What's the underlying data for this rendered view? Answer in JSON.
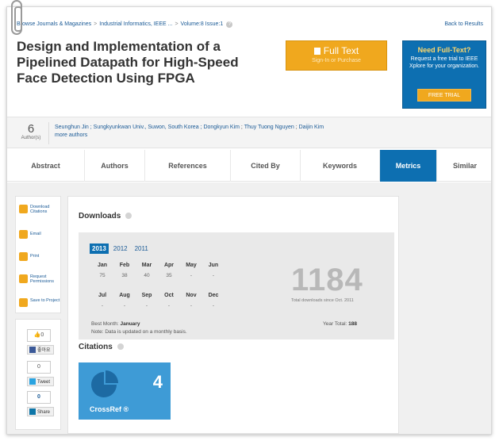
{
  "breadcrumb": {
    "items": [
      "Browse Journals & Magazines",
      "Industrial Informatics, IEEE ...",
      "Volume:8 Issue:1"
    ],
    "separator": ">"
  },
  "back_link": "Back to Results",
  "article": {
    "title": "Design and Implementation of a Pipelined Datapath for High-Speed Face Detection Using FPGA"
  },
  "full_text": {
    "label": "Full Text",
    "sub_label": "Sign-In or Purchase"
  },
  "promo": {
    "heading": "Need Full-Text?",
    "text": "Request a free trial to IEEE Xplore for your organization.",
    "button": "FREE TRIAL"
  },
  "authors": {
    "count": "6",
    "count_label": "Author(s)",
    "first": "Seunghun Jin ; Sungkyunkwan Univ., Suwon, South Korea ;",
    "links": [
      "Dongkyun Kim",
      "Thuy Tuong Nguyen",
      "Daijin Kim"
    ],
    "more": "more authors"
  },
  "tabs": [
    "Abstract",
    "Authors",
    "References",
    "Cited By",
    "Keywords",
    "Metrics",
    "Similar"
  ],
  "active_tab": "Metrics",
  "tools": [
    "Download Citations",
    "Email",
    "Print",
    "Request Permissions",
    "Save to Project"
  ],
  "social": {
    "like_count": "0",
    "like_label": "좋아요",
    "tweet_count": "0",
    "tweet_label": "Tweet",
    "share_count": "0",
    "share_label": "Share"
  },
  "downloads": {
    "title": "Downloads",
    "years": [
      "2013",
      "2012",
      "2011"
    ],
    "active_year": "2013",
    "months_row1": [
      "Jan",
      "Feb",
      "Mar",
      "Apr",
      "May",
      "Jun"
    ],
    "values_row1": [
      "75",
      "38",
      "40",
      "35",
      "-",
      "-"
    ],
    "months_row2": [
      "Jul",
      "Aug",
      "Sep",
      "Oct",
      "Nov",
      "Dec"
    ],
    "values_row2": [
      "-",
      "-",
      "-",
      "-",
      "-",
      "-"
    ],
    "total": "1184",
    "total_caption": "Total downloads since Oct. 2011",
    "best_month_label": "Best Month:",
    "best_month": "January",
    "year_total_label": "Year Total:",
    "year_total": "188",
    "note": "Note: Data is updated on a monthly basis."
  },
  "citations": {
    "title": "Citations",
    "count": "4",
    "source": "CrossRef ®"
  },
  "colors": {
    "accent_blue": "#0d6fb1",
    "orange": "#f0a81e",
    "crossref_blue": "#3e9bd6"
  }
}
